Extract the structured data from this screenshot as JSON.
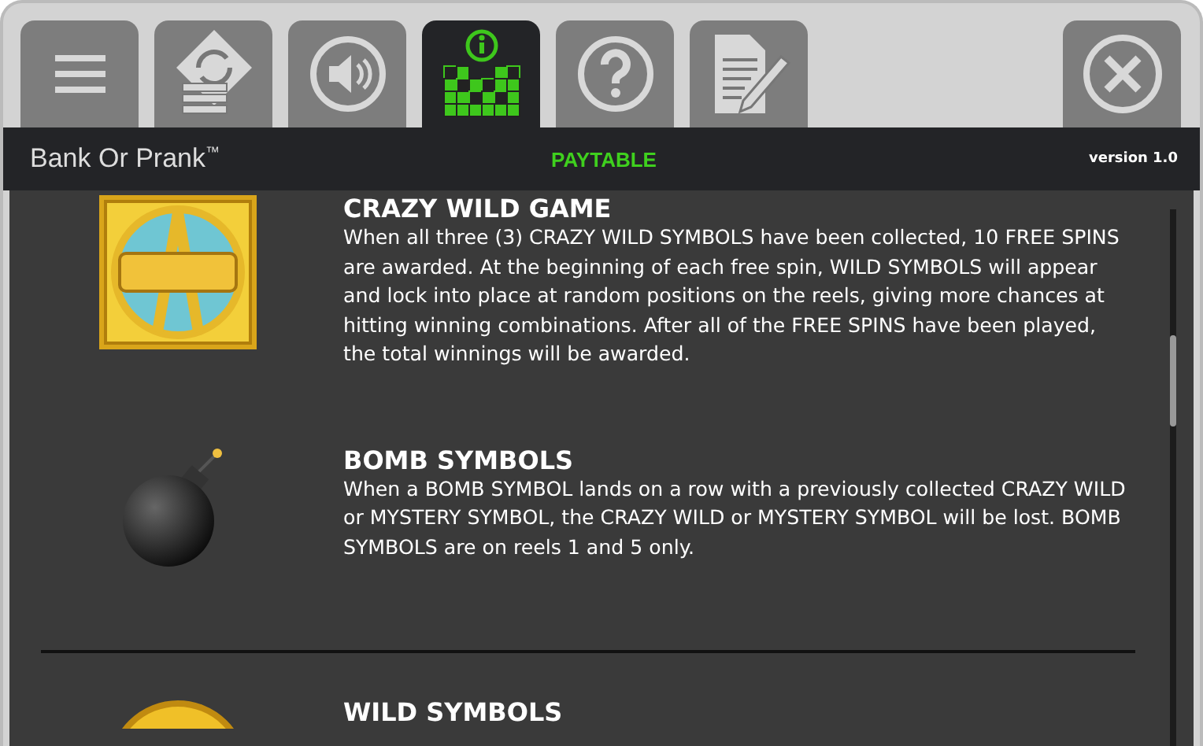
{
  "tabs": [
    {
      "kind": "menu",
      "selected": false
    },
    {
      "kind": "autoplay",
      "selected": false
    },
    {
      "kind": "sound",
      "selected": false
    },
    {
      "kind": "paytable",
      "selected": true
    },
    {
      "kind": "help",
      "selected": false
    },
    {
      "kind": "history",
      "selected": false
    },
    {
      "kind": "close",
      "selected": false
    }
  ],
  "header": {
    "game_title": "Bank Or Prank$^{™}$",
    "page_title": "PAYTABLE",
    "version": "version 1.0"
  },
  "sections": [
    {
      "kind": "wild",
      "title": "CRAZY WILD GAME",
      "text": "When all three (3) CRAZY WILD SYMBOLS have been collected, 10 FREE SPINS are awarded. At the beginning of each free spin, WILD SYMBOLS will appear and lock into place at random positions on the reels, giving more chances at hitting winning combinations. After all of the FREE SPINS have been played, the total winnings will be awarded."
    },
    {
      "kind": "bomb",
      "title": "BOMB SYMBOLS",
      "text": "When a BOMB SYMBOL lands on a row with a previously collected CRAZY WILD or MYSTERY SYMBOL, the CRAZY WILD or MYSTERY SYMBOL will be lost. BOMB SYMBOLS are on reels 1 and 5 only."
    },
    {
      "kind": "coin",
      "divider": true,
      "title": "WILD SYMBOLS"
    }
  ]
}
